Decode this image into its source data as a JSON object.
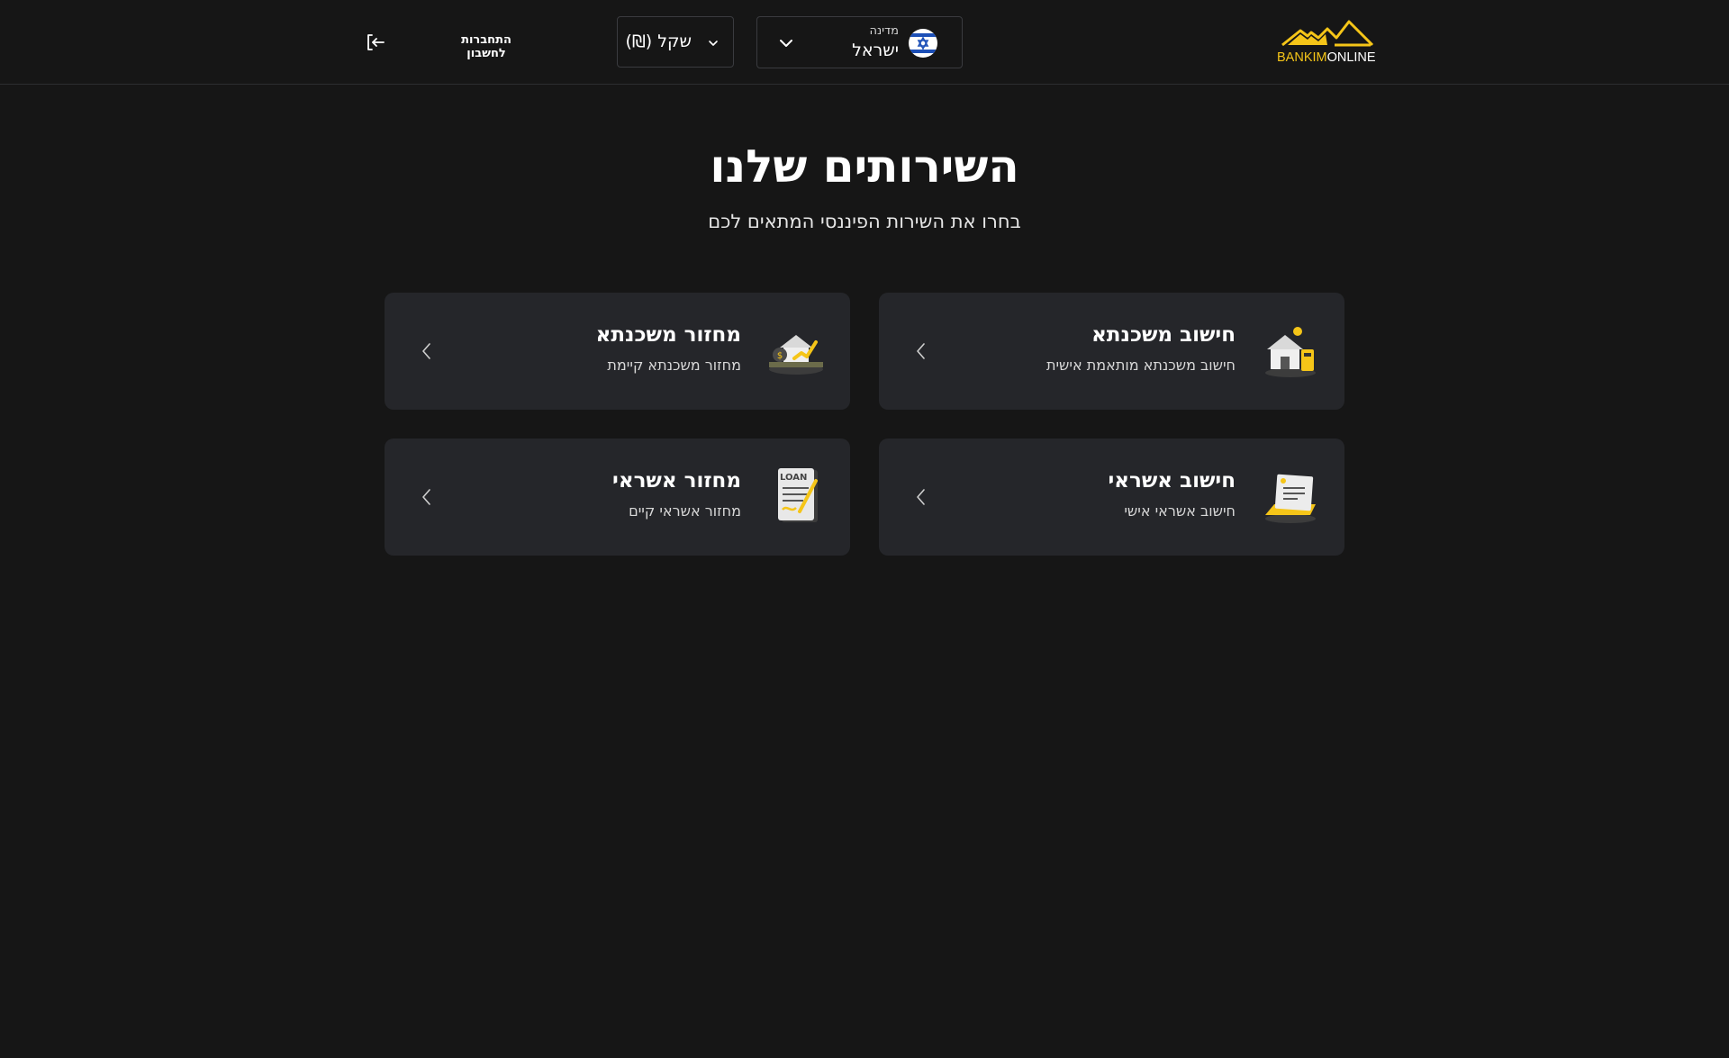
{
  "header": {
    "logo": {
      "part1": "BANKIM",
      "part2": "ONLINE"
    },
    "country": {
      "caption": "מדינה",
      "value": "ישראל",
      "icon": "israel-flag-icon"
    },
    "currency": {
      "value": "(₪) שקל"
    },
    "login": {
      "label": "התחברות לחשבון",
      "icon": "login-arrow-icon"
    }
  },
  "main": {
    "title": "השירותים שלנו",
    "subtitle": "בחרו את השירות הפיננסי המתאים לכם",
    "cards": [
      {
        "title": "חישוב משכנתא",
        "description": "חישוב משכנתא מותאמת אישית",
        "icon": "house-calculator-icon"
      },
      {
        "title": "מחזור משכנתא",
        "description": "מחזור משכנתא קיימת",
        "icon": "house-refinance-icon"
      },
      {
        "title": "חישוב אשראי",
        "description": "חישוב אשראי אישי",
        "icon": "credit-document-icon"
      },
      {
        "title": "מחזור אשראי",
        "description": "מחזור אשראי קיים",
        "icon": "loan-document-icon"
      }
    ]
  },
  "colors": {
    "background": "#161616",
    "card": "#25262a",
    "accent": "#f5c518",
    "border": "#3a3b3f"
  }
}
